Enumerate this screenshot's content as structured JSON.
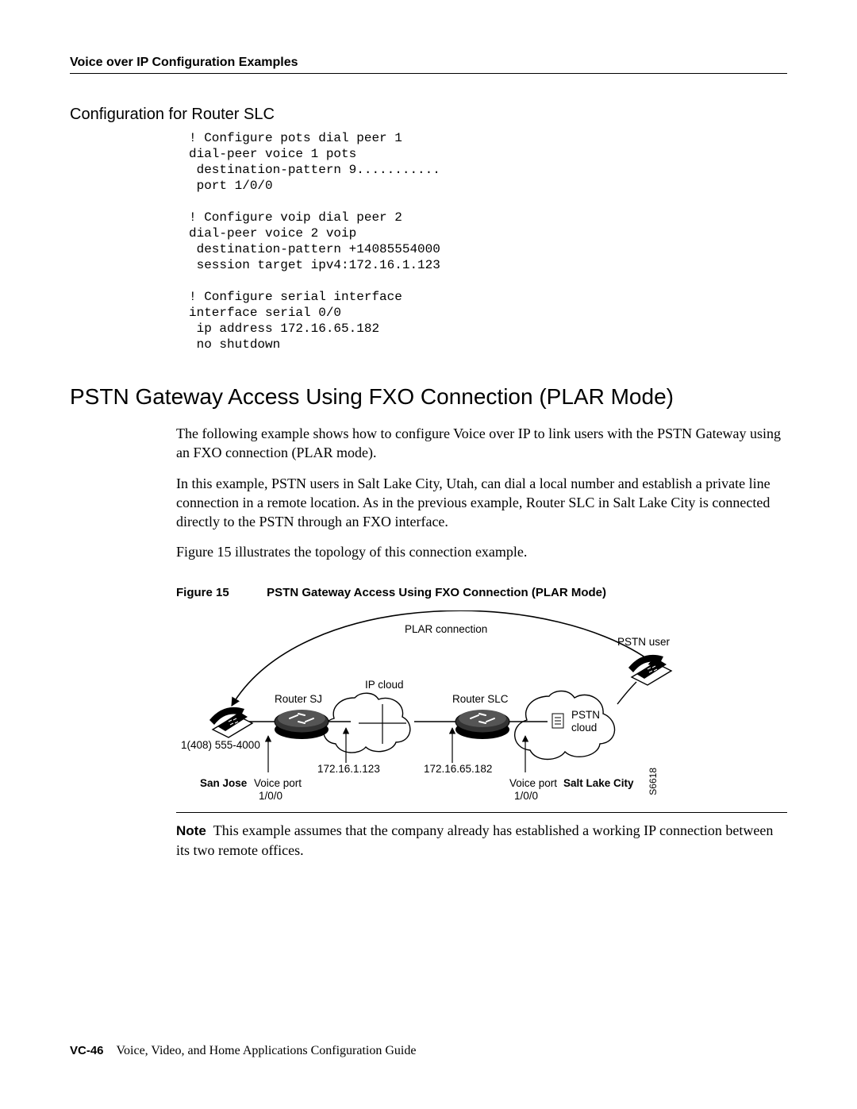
{
  "header": {
    "running_head": "Voice over IP Configuration Examples"
  },
  "section_config_slc": {
    "title": "Configuration for Router SLC",
    "code": "! Configure pots dial peer 1\ndial-peer voice 1 pots\n destination-pattern 9...........\n port 1/0/0\n\n! Configure voip dial peer 2\ndial-peer voice 2 voip\n destination-pattern +14085554000\n session target ipv4:172.16.1.123\n\n! Configure serial interface\ninterface serial 0/0\n ip address 172.16.65.182\n no shutdown"
  },
  "section_main": {
    "title": "PSTN Gateway Access Using FXO Connection (PLAR Mode)",
    "para1": "The following example shows how to configure Voice over IP to link users with the PSTN Gateway using an FXO connection (PLAR mode).",
    "para2": "In this example, PSTN users in Salt Lake City, Utah, can dial a local number and establish a private line connection in a remote location. As in the previous example, Router SLC in Salt Lake City is connected directly to the PSTN through an FXO interface.",
    "para3": "Figure 15 illustrates the topology of this connection example."
  },
  "figure": {
    "number": "Figure 15",
    "caption": "PSTN Gateway Access Using FXO Connection (PLAR Mode)",
    "labels": {
      "plar": "PLAR connection",
      "pstn_user": "PSTN user",
      "router_sj": "Router SJ",
      "ip_cloud": "IP cloud",
      "router_slc": "Router SLC",
      "pstn_cloud_1": "PSTN",
      "pstn_cloud_2": "cloud",
      "phone_number": "1(408) 555-4000",
      "ip_sj": "172.16.1.123",
      "ip_slc": "172.16.65.182",
      "san_jose": "San Jose",
      "voice_port": "Voice port",
      "port_num": "1/0/0",
      "salt_lake": "Salt Lake City",
      "side_id": "S6618"
    }
  },
  "note": {
    "label": "Note",
    "text": "This example assumes that the company already has established a working IP connection between its two remote offices."
  },
  "footer": {
    "page": "VC-46",
    "book": "Voice, Video, and Home Applications Configuration Guide"
  }
}
